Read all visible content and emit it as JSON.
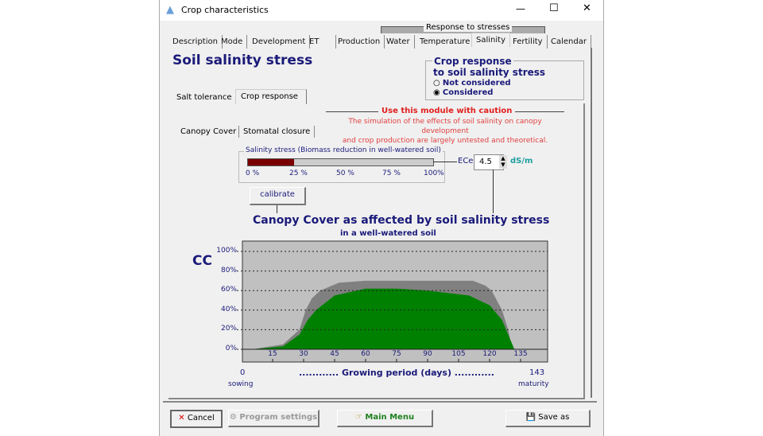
{
  "window": {
    "title": "Crop characteristics",
    "minimize": "—",
    "maximize": "☐",
    "close": "✕"
  },
  "tabs": {
    "group_label": "Response to stresses",
    "items": [
      "Description",
      "Mode",
      "Development",
      "ET",
      "Production",
      "Water",
      "Temperature",
      "Salinity",
      "Fertility",
      "Calendar"
    ],
    "selected": "Salinity"
  },
  "page_title": "Soil salinity stress",
  "crop_response": {
    "title_line1": "Crop response",
    "title_line2": "to soil salinity stress",
    "options": [
      "Not considered",
      "Considered"
    ],
    "selected": "Considered"
  },
  "subtabs": {
    "items": [
      "Salt tolerance",
      "Crop response"
    ],
    "selected": "Crop response"
  },
  "caution": {
    "title": "Use this module with caution",
    "line1": "The simulation of the effects of soil salinity on canopy development",
    "line2": "and crop production are largely untested and theoretical."
  },
  "inner_tabs": {
    "items": [
      "Canopy Cover",
      "Stomatal closure"
    ],
    "selected": "Canopy Cover"
  },
  "salinity_stress": {
    "label": "Salinity stress (Biomass reduction in well-watered soil)",
    "value_percent": 25,
    "ticks": [
      "0 %",
      "25 %",
      "50 %",
      "75 %",
      "100%"
    ],
    "color": "#7a0000"
  },
  "ece": {
    "label": "ECe",
    "value": "4.5",
    "unit": "dS/m"
  },
  "calibrate_label": "calibrate",
  "chart_data": {
    "type": "area",
    "title": "Canopy Cover as affected by soil salinity stress",
    "subtitle": "in a well-watered soil",
    "ylabel": "CC",
    "xlabel": "............ Growing period (days) ............",
    "x_start": "0",
    "x_start_label": "sowing",
    "x_end": "143",
    "x_end_label": "maturity",
    "xlim": [
      0,
      143
    ],
    "ylim": [
      0,
      100
    ],
    "yticks": [
      "0%",
      "20%",
      "40%",
      "60%",
      "80%",
      "100%"
    ],
    "xticks": [
      "15",
      "30",
      "45",
      "60",
      "75",
      "90",
      "105",
      "120",
      "135"
    ],
    "grid": true,
    "series": [
      {
        "color": "#808080",
        "x": [
          0,
          5,
          20,
          28,
          31,
          34,
          38,
          47,
          60,
          112,
          118,
          121,
          126,
          129,
          131
        ],
        "y": [
          0,
          0,
          5,
          20,
          40,
          52,
          60,
          68,
          70,
          70,
          65,
          60,
          40,
          20,
          0
        ]
      },
      {
        "color": "#008000",
        "x": [
          0,
          5,
          20,
          28,
          32,
          36,
          45,
          60,
          75,
          90,
          110,
          120,
          126,
          130,
          132
        ],
        "y": [
          0,
          0,
          3,
          15,
          30,
          40,
          55,
          62,
          62,
          60,
          55,
          45,
          30,
          10,
          0
        ]
      }
    ]
  },
  "footer": {
    "cancel": "Cancel",
    "program_settings": "Program settings",
    "main_menu": "Main Menu",
    "save_as": "Save as"
  }
}
